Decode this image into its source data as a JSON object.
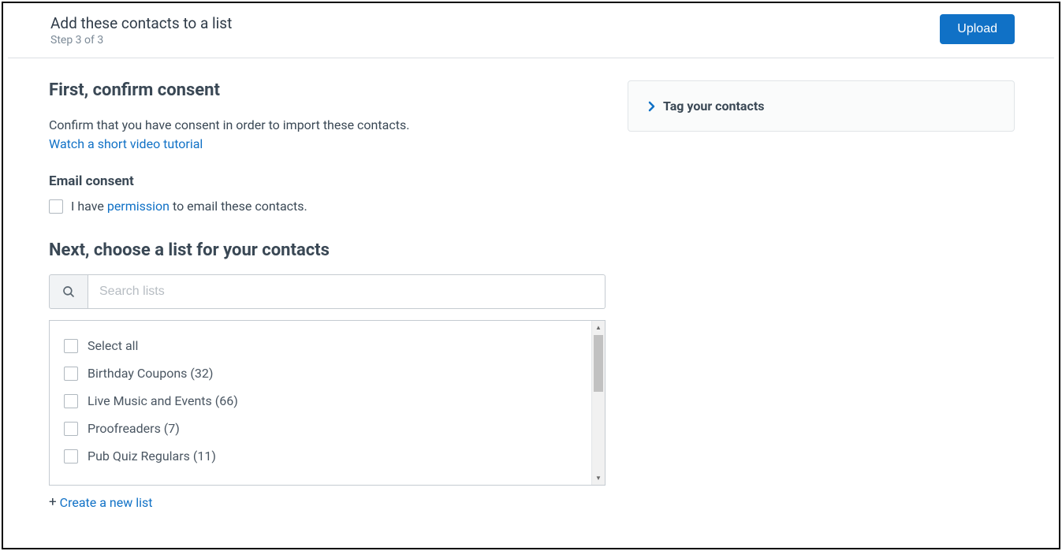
{
  "header": {
    "title": "Add these contacts to a list",
    "step": "Step 3 of 3",
    "upload_label": "Upload"
  },
  "consent": {
    "title": "First, confirm consent",
    "description": "Confirm that you have consent in order to import these contacts.",
    "video_link": "Watch a short video tutorial",
    "email_title": "Email consent",
    "label_prefix": "I have ",
    "permission_word": "permission",
    "label_suffix": " to email these contacts."
  },
  "lists": {
    "title": "Next, choose a list for your contacts",
    "search_placeholder": "Search lists",
    "items": [
      "Select all",
      "Birthday Coupons (32)",
      "Live Music and Events (66)",
      "Proofreaders (7)",
      "Pub Quiz Regulars (11)"
    ],
    "create_link": "Create a new list"
  },
  "sidebar": {
    "tag_title": "Tag your contacts"
  },
  "colors": {
    "accent": "#1071c6"
  }
}
